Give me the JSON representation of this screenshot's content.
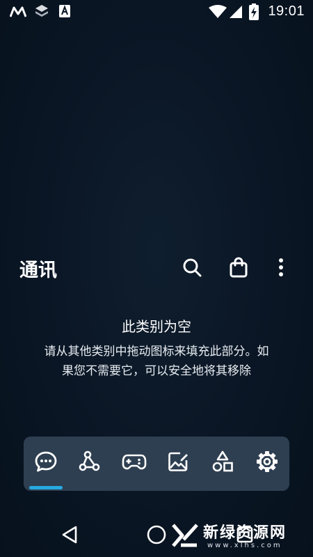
{
  "status_bar": {
    "time": "19:01",
    "icons": [
      "m-app-icon",
      "stack-app-icon",
      "a-app-icon",
      "wifi-icon",
      "signal-icon",
      "battery-charging-icon"
    ]
  },
  "header": {
    "title": "通讯",
    "actions": [
      "search-icon",
      "shopping-bag-icon",
      "more-vertical-icon"
    ]
  },
  "empty_state": {
    "title": "此类别为空",
    "description": "请从其他类别中拖动图标来填充此部分。如果您不需要它，可以安全地将其移除"
  },
  "dock": {
    "categories": [
      {
        "icon": "chat-bubble-icon",
        "selected": true
      },
      {
        "icon": "connections-icon",
        "selected": false
      },
      {
        "icon": "gamepad-icon",
        "selected": false
      },
      {
        "icon": "image-edit-icon",
        "selected": false
      },
      {
        "icon": "shapes-icon",
        "selected": false
      },
      {
        "icon": "settings-gear-icon",
        "selected": false
      }
    ],
    "accent_color": "#27a9e1"
  },
  "nav_bar": {
    "buttons": [
      "back-triangle-icon",
      "home-circle-icon",
      "recents-square-icon"
    ]
  },
  "watermark": {
    "main": "新绿资源网",
    "sub": "www.xlhs.com"
  },
  "colors": {
    "background": "#0b1726",
    "dock": "#2f3f52",
    "text": "#ffffff"
  }
}
